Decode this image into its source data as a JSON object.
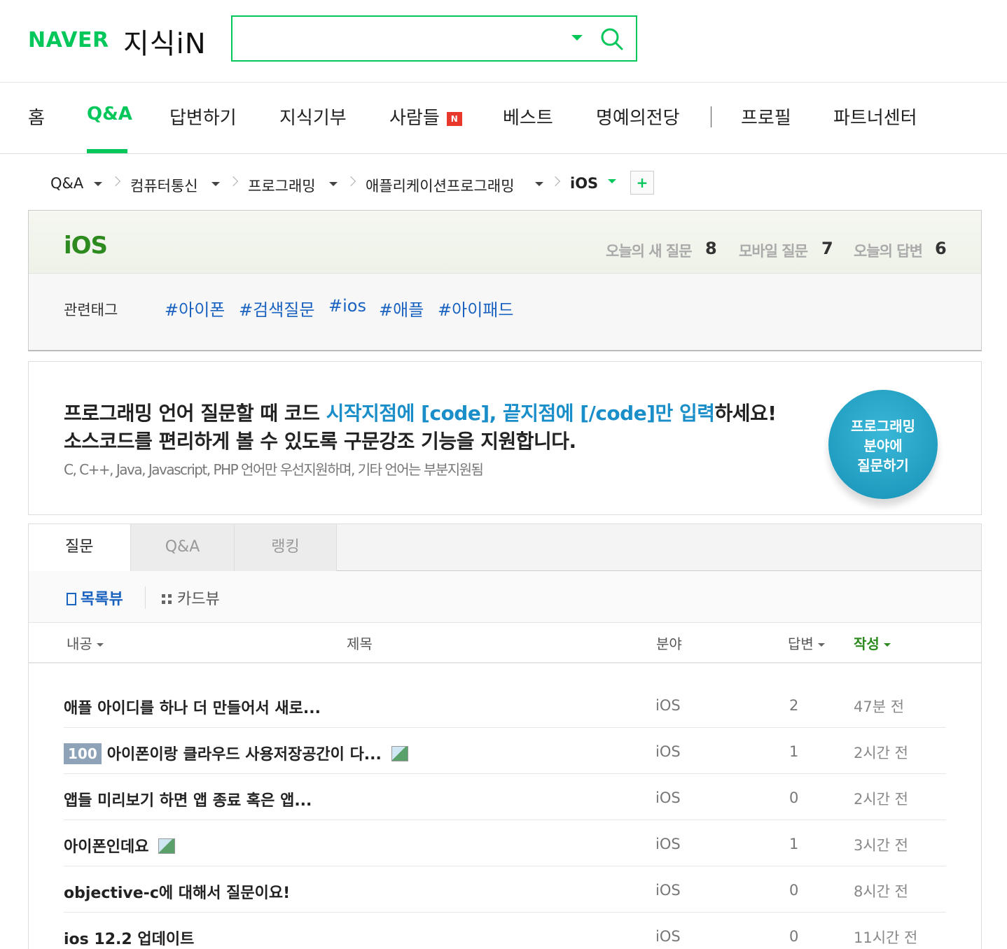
{
  "header": {
    "naver_logo": "NAVER",
    "service_logo": "지식iN",
    "search": {
      "value": "",
      "placeholder": ""
    }
  },
  "nav": {
    "items": [
      {
        "label": "홈"
      },
      {
        "label": "Q&A"
      },
      {
        "label": "답변하기"
      },
      {
        "label": "지식기부"
      },
      {
        "label": "사람들",
        "badge": "N"
      },
      {
        "label": "베스트"
      },
      {
        "label": "명예의전당"
      },
      {
        "label": "프로필"
      },
      {
        "label": "파트너센터"
      }
    ],
    "active_index": 1
  },
  "breadcrumb": {
    "items": [
      "Q&A",
      "컴퓨터통신",
      "프로그래밍",
      "애플리케이션프로그래밍",
      "iOS"
    ],
    "add_label": "+"
  },
  "category": {
    "title": "iOS",
    "stats": [
      {
        "label": "오늘의 새 질문",
        "value": "8"
      },
      {
        "label": "모바일 질문",
        "value": "7"
      },
      {
        "label": "오늘의 답변",
        "value": "6"
      }
    ],
    "tags_label": "관련태그",
    "tags": [
      "#아이폰",
      "#검색질문",
      "#ios",
      "#애플",
      "#아이패드"
    ]
  },
  "banner": {
    "line1_a": "프로그래밍 언어 질문할 때 코드 ",
    "line1_hl": "시작지점에 [code], 끝지점에 [/code]만 입력",
    "line1_b": "하세요!",
    "line2": "소스코드를 편리하게 볼 수 있도록 구문강조 기능을 지원합니다.",
    "sub": "C, C++, Java, Javascript, PHP 언어만 우선지원하며, 기타 언어는 부분지원됨",
    "ask_button": [
      "프로그래밍",
      "분야에",
      "질문하기"
    ]
  },
  "tabs": [
    {
      "label": "질문"
    },
    {
      "label": "Q&A"
    },
    {
      "label": "랭킹"
    }
  ],
  "view": {
    "list": "목록뷰",
    "card": "카드뷰"
  },
  "table": {
    "headers": {
      "bounty": "내공",
      "title": "제목",
      "field": "분야",
      "answers": "답변",
      "written": "작성"
    },
    "rows": [
      {
        "bounty": "",
        "title": "애플 아이디를 하나 더 만들어서 새로...",
        "has_image": false,
        "field": "iOS",
        "answers": "2",
        "time": "47분 전"
      },
      {
        "bounty": "100",
        "title": "아이폰이랑 클라우드 사용저장공간이 다...",
        "has_image": true,
        "field": "iOS",
        "answers": "1",
        "time": "2시간 전"
      },
      {
        "bounty": "",
        "title": "앱들 미리보기 하면 앱 종료 혹은 앱...",
        "has_image": false,
        "field": "iOS",
        "answers": "0",
        "time": "2시간 전"
      },
      {
        "bounty": "",
        "title": "아이폰인데요",
        "has_image": true,
        "field": "iOS",
        "answers": "1",
        "time": "3시간 전"
      },
      {
        "bounty": "",
        "title": "objective-c에 대해서 질문이요!",
        "has_image": false,
        "field": "iOS",
        "answers": "0",
        "time": "8시간 전"
      },
      {
        "bounty": "",
        "title": "ios 12.2 업데이트",
        "has_image": false,
        "field": "iOS",
        "answers": "0",
        "time": "11시간 전"
      }
    ]
  },
  "colors": {
    "brand": "#03c75a",
    "link": "#1a62c0",
    "highlight": "#1a8ec9"
  }
}
